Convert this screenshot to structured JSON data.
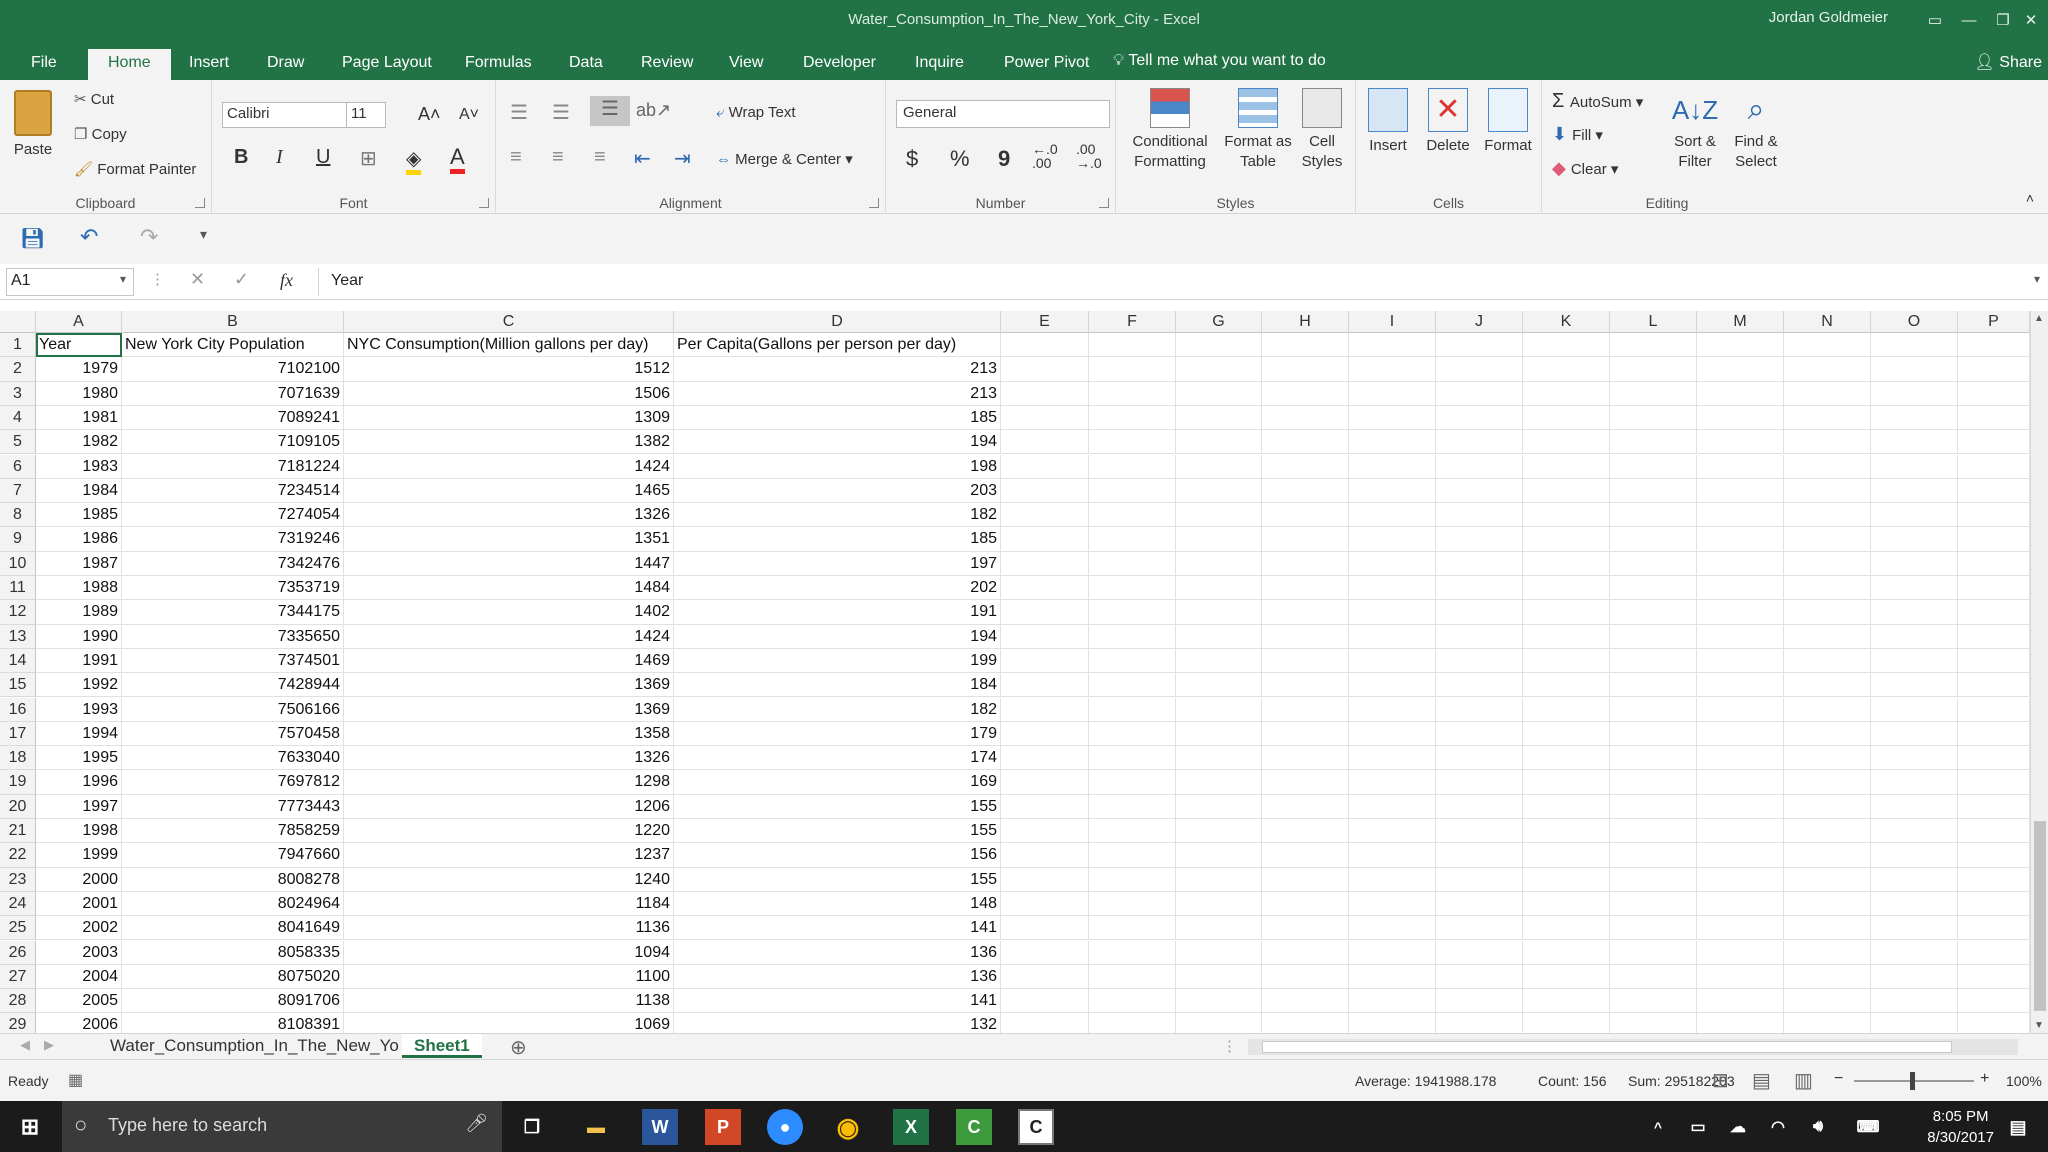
{
  "window": {
    "title": "Water_Consumption_In_The_New_York_City  -  Excel",
    "user": "Jordan Goldmeier"
  },
  "ribbon_tabs": [
    "File",
    "Home",
    "Insert",
    "Draw",
    "Page Layout",
    "Formulas",
    "Data",
    "Review",
    "View",
    "Developer",
    "Inquire",
    "Power Pivot"
  ],
  "tell_me": "Tell me what you want to do",
  "share": "Share",
  "clipboard": {
    "paste": "Paste",
    "cut": "Cut",
    "copy": "Copy",
    "format_painter": "Format Painter",
    "label": "Clipboard"
  },
  "font": {
    "name": "Calibri",
    "size": "11",
    "bold": "B",
    "italic": "I",
    "underline": "U",
    "label": "Font"
  },
  "alignment": {
    "wrap": "Wrap Text",
    "merge": "Merge & Center",
    "label": "Alignment"
  },
  "number": {
    "format": "General",
    "currency": "$",
    "percent": "%",
    "comma": "9",
    "inc": "←.0\n.00",
    "dec": ".00\n→.0",
    "label": "Number"
  },
  "styles": {
    "conditional": "Conditional\nFormatting",
    "format_table": "Format as\nTable",
    "cell_styles": "Cell\nStyles",
    "label": "Styles"
  },
  "cells": {
    "insert": "Insert",
    "delete": "Delete",
    "format": "Format",
    "label": "Cells"
  },
  "editing": {
    "autosum": "AutoSum",
    "fill": "Fill",
    "clear": "Clear",
    "sort": "Sort &\nFilter",
    "find": "Find &\nSelect",
    "label": "Editing"
  },
  "formula_bar": {
    "name_box": "A1",
    "value": "Year",
    "fx": "fx"
  },
  "columns": [
    "A",
    "B",
    "C",
    "D",
    "E",
    "F",
    "G",
    "H",
    "I",
    "J",
    "K",
    "L",
    "M",
    "N",
    "O",
    "P"
  ],
  "headers": {
    "A": "Year",
    "B": "New York City Population",
    "C": "NYC Consumption(Million gallons per day)",
    "D": "Per Capita(Gallons per person per day)"
  },
  "rows": [
    [
      "1979",
      "7102100",
      "1512",
      "213"
    ],
    [
      "1980",
      "7071639",
      "1506",
      "213"
    ],
    [
      "1981",
      "7089241",
      "1309",
      "185"
    ],
    [
      "1982",
      "7109105",
      "1382",
      "194"
    ],
    [
      "1983",
      "7181224",
      "1424",
      "198"
    ],
    [
      "1984",
      "7234514",
      "1465",
      "203"
    ],
    [
      "1985",
      "7274054",
      "1326",
      "182"
    ],
    [
      "1986",
      "7319246",
      "1351",
      "185"
    ],
    [
      "1987",
      "7342476",
      "1447",
      "197"
    ],
    [
      "1988",
      "7353719",
      "1484",
      "202"
    ],
    [
      "1989",
      "7344175",
      "1402",
      "191"
    ],
    [
      "1990",
      "7335650",
      "1424",
      "194"
    ],
    [
      "1991",
      "7374501",
      "1469",
      "199"
    ],
    [
      "1992",
      "7428944",
      "1369",
      "184"
    ],
    [
      "1993",
      "7506166",
      "1369",
      "182"
    ],
    [
      "1994",
      "7570458",
      "1358",
      "179"
    ],
    [
      "1995",
      "7633040",
      "1326",
      "174"
    ],
    [
      "1996",
      "7697812",
      "1298",
      "169"
    ],
    [
      "1997",
      "7773443",
      "1206",
      "155"
    ],
    [
      "1998",
      "7858259",
      "1220",
      "155"
    ],
    [
      "1999",
      "7947660",
      "1237",
      "156"
    ],
    [
      "2000",
      "8008278",
      "1240",
      "155"
    ],
    [
      "2001",
      "8024964",
      "1184",
      "148"
    ],
    [
      "2002",
      "8041649",
      "1136",
      "141"
    ],
    [
      "2003",
      "8058335",
      "1094",
      "136"
    ],
    [
      "2004",
      "8075020",
      "1100",
      "136"
    ],
    [
      "2005",
      "8091706",
      "1138",
      "141"
    ],
    [
      "2006",
      "8108391",
      "1069",
      "132"
    ]
  ],
  "sheets": [
    "Water_Consumption_In_The_New_Yo",
    "Sheet1"
  ],
  "status": {
    "ready": "Ready",
    "average": "Average: 1941988.178",
    "count": "Count: 156",
    "sum": "Sum: 295182203",
    "zoom": "100%"
  },
  "taskbar": {
    "search": "Type here to search",
    "time": "8:05 PM",
    "date": "8/30/2017"
  },
  "colors": {
    "excel_green": "#217346"
  }
}
